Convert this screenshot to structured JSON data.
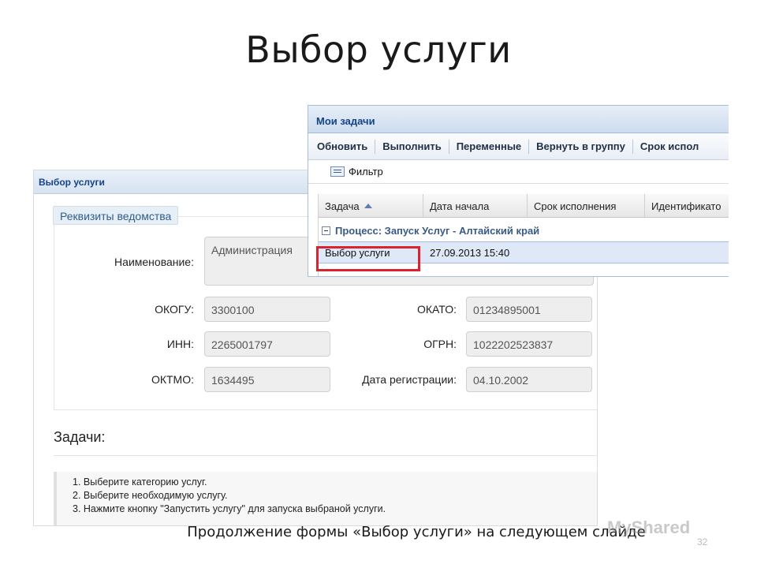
{
  "slide": {
    "title": "Выбор услуги",
    "subtitle": "Продолжение формы «Выбор услуги» на следующем слайде",
    "page_number": "32",
    "watermark": "MyShared"
  },
  "service_form": {
    "header": "Выбор услуги",
    "section_legend": "Реквизиты ведомства",
    "fields": {
      "name_label": "Наименование:",
      "name_value": "Администрация",
      "okogu_label": "ОКОГУ:",
      "okogu_value": "3300100",
      "okato_label": "ОКАТО:",
      "okato_value": "01234895001",
      "inn_label": "ИНН:",
      "inn_value": "2265001797",
      "ogrn_label": "ОГРН:",
      "ogrn_value": "1022202523837",
      "oktmo_label": "ОКТМО:",
      "oktmo_value": "1634495",
      "regdate_label": "Дата регистрации:",
      "regdate_value": "04.10.2002"
    },
    "tasks_title": "Задачи:",
    "tasks": [
      "1. Выберите категорию услуг.",
      "2. Выберите необходимую услугу.",
      "3. Нажмите кнопку \"Запустить услугу\" для запуска выбраной услуги."
    ]
  },
  "my_tasks": {
    "header": "Мои задачи",
    "toolbar": [
      "Обновить",
      "Выполнить",
      "Переменные",
      "Вернуть в группу",
      "Срок испол"
    ],
    "filter_label": "Фильтр",
    "columns": [
      "Задача",
      "Дата начала",
      "Срок исполнения",
      "Идентификато"
    ],
    "group_label": "Процесс: Запуск Услуг - Алтайский край",
    "rows": [
      {
        "task": "Выбор услуги",
        "start_date": "27.09.2013 15:40"
      }
    ]
  },
  "colors": {
    "panel_header_text": "#15428b",
    "highlight": "#d9232f",
    "selected_row": "#dfe8f6"
  },
  "icons": {
    "filter": "filter-icon",
    "sort": "sort-ascending-icon",
    "collapse": "minus-icon"
  }
}
